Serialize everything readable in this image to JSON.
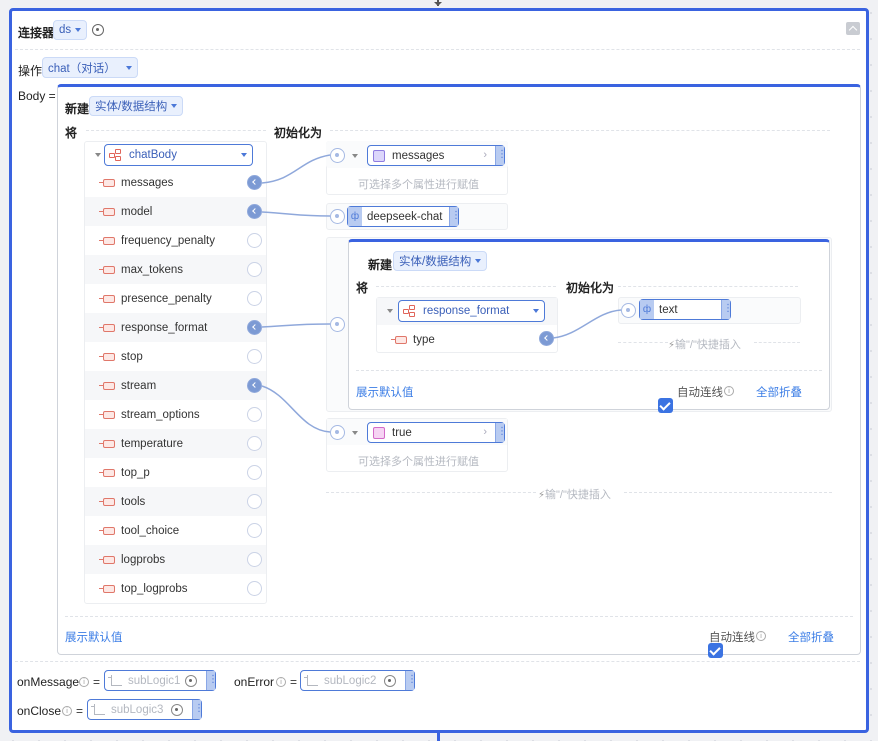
{
  "connector": {
    "label": "连接器",
    "value": "ds",
    "locate_icon": "target-icon"
  },
  "operation": {
    "label": "操作",
    "value": "chat（对话）"
  },
  "body": {
    "label": "Body =",
    "new_label": "新建",
    "type_select": "实体/数据结构",
    "left_header": "将",
    "right_header": "初始化为",
    "entity": "chatBody",
    "properties": [
      {
        "name": "messages",
        "linked": true
      },
      {
        "name": "model",
        "linked": true
      },
      {
        "name": "frequency_penalty",
        "linked": false
      },
      {
        "name": "max_tokens",
        "linked": false
      },
      {
        "name": "presence_penalty",
        "linked": false
      },
      {
        "name": "response_format",
        "linked": true
      },
      {
        "name": "stop",
        "linked": false
      },
      {
        "name": "stream",
        "linked": true
      },
      {
        "name": "stream_options",
        "linked": false
      },
      {
        "name": "temperature",
        "linked": false
      },
      {
        "name": "top_p",
        "linked": false
      },
      {
        "name": "tools",
        "linked": false
      },
      {
        "name": "tool_choice",
        "linked": false
      },
      {
        "name": "logprobs",
        "linked": false
      },
      {
        "name": "top_logprobs",
        "linked": false
      }
    ],
    "values": {
      "messages": {
        "value": "messages",
        "hint": "可选择多个属性进行赋值"
      },
      "model": {
        "value": "deepseek-chat"
      },
      "stream": {
        "value": "true",
        "hint": "可选择多个属性进行赋值"
      }
    },
    "nested": {
      "new_label": "新建",
      "type_select": "实体/数据结构",
      "left_header": "将",
      "right_header": "初始化为",
      "entity": "response_format",
      "properties": [
        {
          "name": "type",
          "linked": true
        }
      ],
      "value": "text",
      "quick_insert": "输\"/\"快捷插入",
      "show_default": "展示默认值",
      "auto_connect": "自动连线",
      "auto_connect_checked": true,
      "collapse_all": "全部折叠"
    },
    "quick_insert": "输\"/\"快捷插入",
    "show_default": "展示默认值",
    "auto_connect": "自动连线",
    "auto_connect_checked": true,
    "collapse_all": "全部折叠"
  },
  "callbacks": [
    {
      "label": "onMessage",
      "eq": "=",
      "value": "subLogic1"
    },
    {
      "label": "onError",
      "eq": "=",
      "value": "subLogic2"
    },
    {
      "label": "onClose",
      "eq": "=",
      "value": "subLogic3"
    }
  ],
  "colors": {
    "accent": "#3a63e0",
    "link": "#3b7de6",
    "connector_line": "#8fa8db"
  }
}
